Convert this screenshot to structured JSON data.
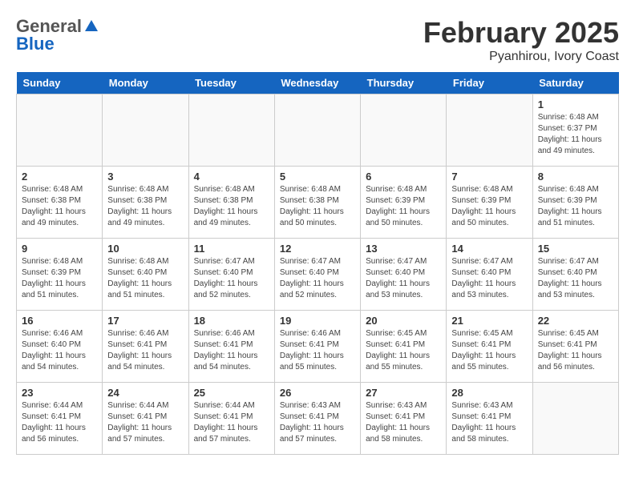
{
  "logo": {
    "general": "General",
    "blue": "Blue"
  },
  "title": {
    "month": "February 2025",
    "location": "Pyanhirou, Ivory Coast"
  },
  "weekdays": [
    "Sunday",
    "Monday",
    "Tuesday",
    "Wednesday",
    "Thursday",
    "Friday",
    "Saturday"
  ],
  "weeks": [
    [
      {
        "day": "",
        "info": ""
      },
      {
        "day": "",
        "info": ""
      },
      {
        "day": "",
        "info": ""
      },
      {
        "day": "",
        "info": ""
      },
      {
        "day": "",
        "info": ""
      },
      {
        "day": "",
        "info": ""
      },
      {
        "day": "1",
        "info": "Sunrise: 6:48 AM\nSunset: 6:37 PM\nDaylight: 11 hours and 49 minutes."
      }
    ],
    [
      {
        "day": "2",
        "info": "Sunrise: 6:48 AM\nSunset: 6:38 PM\nDaylight: 11 hours and 49 minutes."
      },
      {
        "day": "3",
        "info": "Sunrise: 6:48 AM\nSunset: 6:38 PM\nDaylight: 11 hours and 49 minutes."
      },
      {
        "day": "4",
        "info": "Sunrise: 6:48 AM\nSunset: 6:38 PM\nDaylight: 11 hours and 49 minutes."
      },
      {
        "day": "5",
        "info": "Sunrise: 6:48 AM\nSunset: 6:38 PM\nDaylight: 11 hours and 50 minutes."
      },
      {
        "day": "6",
        "info": "Sunrise: 6:48 AM\nSunset: 6:39 PM\nDaylight: 11 hours and 50 minutes."
      },
      {
        "day": "7",
        "info": "Sunrise: 6:48 AM\nSunset: 6:39 PM\nDaylight: 11 hours and 50 minutes."
      },
      {
        "day": "8",
        "info": "Sunrise: 6:48 AM\nSunset: 6:39 PM\nDaylight: 11 hours and 51 minutes."
      }
    ],
    [
      {
        "day": "9",
        "info": "Sunrise: 6:48 AM\nSunset: 6:39 PM\nDaylight: 11 hours and 51 minutes."
      },
      {
        "day": "10",
        "info": "Sunrise: 6:48 AM\nSunset: 6:40 PM\nDaylight: 11 hours and 51 minutes."
      },
      {
        "day": "11",
        "info": "Sunrise: 6:47 AM\nSunset: 6:40 PM\nDaylight: 11 hours and 52 minutes."
      },
      {
        "day": "12",
        "info": "Sunrise: 6:47 AM\nSunset: 6:40 PM\nDaylight: 11 hours and 52 minutes."
      },
      {
        "day": "13",
        "info": "Sunrise: 6:47 AM\nSunset: 6:40 PM\nDaylight: 11 hours and 53 minutes."
      },
      {
        "day": "14",
        "info": "Sunrise: 6:47 AM\nSunset: 6:40 PM\nDaylight: 11 hours and 53 minutes."
      },
      {
        "day": "15",
        "info": "Sunrise: 6:47 AM\nSunset: 6:40 PM\nDaylight: 11 hours and 53 minutes."
      }
    ],
    [
      {
        "day": "16",
        "info": "Sunrise: 6:46 AM\nSunset: 6:40 PM\nDaylight: 11 hours and 54 minutes."
      },
      {
        "day": "17",
        "info": "Sunrise: 6:46 AM\nSunset: 6:41 PM\nDaylight: 11 hours and 54 minutes."
      },
      {
        "day": "18",
        "info": "Sunrise: 6:46 AM\nSunset: 6:41 PM\nDaylight: 11 hours and 54 minutes."
      },
      {
        "day": "19",
        "info": "Sunrise: 6:46 AM\nSunset: 6:41 PM\nDaylight: 11 hours and 55 minutes."
      },
      {
        "day": "20",
        "info": "Sunrise: 6:45 AM\nSunset: 6:41 PM\nDaylight: 11 hours and 55 minutes."
      },
      {
        "day": "21",
        "info": "Sunrise: 6:45 AM\nSunset: 6:41 PM\nDaylight: 11 hours and 55 minutes."
      },
      {
        "day": "22",
        "info": "Sunrise: 6:45 AM\nSunset: 6:41 PM\nDaylight: 11 hours and 56 minutes."
      }
    ],
    [
      {
        "day": "23",
        "info": "Sunrise: 6:44 AM\nSunset: 6:41 PM\nDaylight: 11 hours and 56 minutes."
      },
      {
        "day": "24",
        "info": "Sunrise: 6:44 AM\nSunset: 6:41 PM\nDaylight: 11 hours and 57 minutes."
      },
      {
        "day": "25",
        "info": "Sunrise: 6:44 AM\nSunset: 6:41 PM\nDaylight: 11 hours and 57 minutes."
      },
      {
        "day": "26",
        "info": "Sunrise: 6:43 AM\nSunset: 6:41 PM\nDaylight: 11 hours and 57 minutes."
      },
      {
        "day": "27",
        "info": "Sunrise: 6:43 AM\nSunset: 6:41 PM\nDaylight: 11 hours and 58 minutes."
      },
      {
        "day": "28",
        "info": "Sunrise: 6:43 AM\nSunset: 6:41 PM\nDaylight: 11 hours and 58 minutes."
      },
      {
        "day": "",
        "info": ""
      }
    ]
  ]
}
